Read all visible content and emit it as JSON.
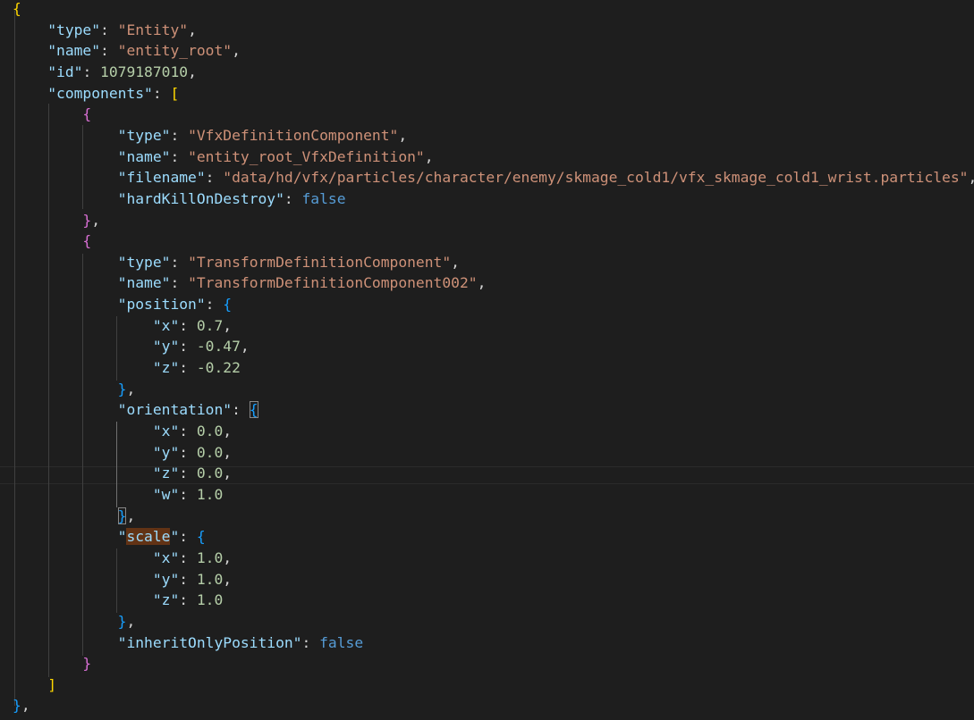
{
  "lines": [
    {
      "indent": 0,
      "tokens": [
        {
          "t": "{",
          "c": "br-gold"
        }
      ]
    },
    {
      "indent": 1,
      "tokens": [
        {
          "t": "\"type\"",
          "c": "k"
        },
        {
          "t": ": ",
          "c": "p"
        },
        {
          "t": "\"Entity\"",
          "c": "s"
        },
        {
          "t": ",",
          "c": "p"
        }
      ]
    },
    {
      "indent": 1,
      "tokens": [
        {
          "t": "\"name\"",
          "c": "k"
        },
        {
          "t": ": ",
          "c": "p"
        },
        {
          "t": "\"entity_root\"",
          "c": "s"
        },
        {
          "t": ",",
          "c": "p"
        }
      ]
    },
    {
      "indent": 1,
      "tokens": [
        {
          "t": "\"id\"",
          "c": "k"
        },
        {
          "t": ": ",
          "c": "p"
        },
        {
          "t": "1079187010",
          "c": "n"
        },
        {
          "t": ",",
          "c": "p"
        }
      ]
    },
    {
      "indent": 1,
      "tokens": [
        {
          "t": "\"components\"",
          "c": "k"
        },
        {
          "t": ": ",
          "c": "p"
        },
        {
          "t": "[",
          "c": "br-gold"
        }
      ]
    },
    {
      "indent": 2,
      "tokens": [
        {
          "t": "{",
          "c": "br-pink"
        }
      ]
    },
    {
      "indent": 3,
      "tokens": [
        {
          "t": "\"type\"",
          "c": "k"
        },
        {
          "t": ": ",
          "c": "p"
        },
        {
          "t": "\"VfxDefinitionComponent\"",
          "c": "s"
        },
        {
          "t": ",",
          "c": "p"
        }
      ]
    },
    {
      "indent": 3,
      "tokens": [
        {
          "t": "\"name\"",
          "c": "k"
        },
        {
          "t": ": ",
          "c": "p"
        },
        {
          "t": "\"entity_root_VfxDefinition\"",
          "c": "s"
        },
        {
          "t": ",",
          "c": "p"
        }
      ]
    },
    {
      "indent": 3,
      "tokens": [
        {
          "t": "\"filename\"",
          "c": "k"
        },
        {
          "t": ": ",
          "c": "p"
        },
        {
          "t": "\"data/hd/vfx/particles/character/enemy/skmage_cold1/vfx_skmage_cold1_wrist.particles\"",
          "c": "s"
        },
        {
          "t": ",",
          "c": "p"
        }
      ]
    },
    {
      "indent": 3,
      "tokens": [
        {
          "t": "\"hardKillOnDestroy\"",
          "c": "k"
        },
        {
          "t": ": ",
          "c": "p"
        },
        {
          "t": "false",
          "c": "b"
        }
      ]
    },
    {
      "indent": 2,
      "tokens": [
        {
          "t": "}",
          "c": "br-pink"
        },
        {
          "t": ",",
          "c": "p"
        }
      ]
    },
    {
      "indent": 2,
      "tokens": [
        {
          "t": "{",
          "c": "br-pink"
        }
      ]
    },
    {
      "indent": 3,
      "tokens": [
        {
          "t": "\"type\"",
          "c": "k"
        },
        {
          "t": ": ",
          "c": "p"
        },
        {
          "t": "\"TransformDefinitionComponent\"",
          "c": "s"
        },
        {
          "t": ",",
          "c": "p"
        }
      ]
    },
    {
      "indent": 3,
      "tokens": [
        {
          "t": "\"name\"",
          "c": "k"
        },
        {
          "t": ": ",
          "c": "p"
        },
        {
          "t": "\"TransformDefinitionComponent002\"",
          "c": "s"
        },
        {
          "t": ",",
          "c": "p"
        }
      ]
    },
    {
      "indent": 3,
      "tokens": [
        {
          "t": "\"position\"",
          "c": "k"
        },
        {
          "t": ": ",
          "c": "p"
        },
        {
          "t": "{",
          "c": "br-blue"
        }
      ]
    },
    {
      "indent": 4,
      "tokens": [
        {
          "t": "\"x\"",
          "c": "k"
        },
        {
          "t": ": ",
          "c": "p"
        },
        {
          "t": "0.7",
          "c": "n"
        },
        {
          "t": ",",
          "c": "p"
        }
      ]
    },
    {
      "indent": 4,
      "tokens": [
        {
          "t": "\"y\"",
          "c": "k"
        },
        {
          "t": ": ",
          "c": "p"
        },
        {
          "t": "-0.47",
          "c": "n"
        },
        {
          "t": ",",
          "c": "p"
        }
      ]
    },
    {
      "indent": 4,
      "tokens": [
        {
          "t": "\"z\"",
          "c": "k"
        },
        {
          "t": ": ",
          "c": "p"
        },
        {
          "t": "-0.22",
          "c": "n"
        }
      ]
    },
    {
      "indent": 3,
      "tokens": [
        {
          "t": "}",
          "c": "br-blue"
        },
        {
          "t": ",",
          "c": "p"
        }
      ]
    },
    {
      "indent": 3,
      "tokens": [
        {
          "t": "\"orientation\"",
          "c": "k"
        },
        {
          "t": ": ",
          "c": "p"
        },
        {
          "t": "{",
          "c": "br-blue",
          "match": true
        }
      ]
    },
    {
      "indent": 4,
      "tokens": [
        {
          "t": "\"x\"",
          "c": "k"
        },
        {
          "t": ": ",
          "c": "p"
        },
        {
          "t": "0.0",
          "c": "n"
        },
        {
          "t": ",",
          "c": "p"
        }
      ]
    },
    {
      "indent": 4,
      "tokens": [
        {
          "t": "\"y\"",
          "c": "k"
        },
        {
          "t": ": ",
          "c": "p"
        },
        {
          "t": "0.0",
          "c": "n"
        },
        {
          "t": ",",
          "c": "p"
        }
      ]
    },
    {
      "indent": 4,
      "tokens": [
        {
          "t": "\"z\"",
          "c": "k"
        },
        {
          "t": ": ",
          "c": "p"
        },
        {
          "t": "0.0",
          "c": "n"
        },
        {
          "t": ",",
          "c": "p"
        }
      ]
    },
    {
      "indent": 4,
      "tokens": [
        {
          "t": "\"w\"",
          "c": "k"
        },
        {
          "t": ": ",
          "c": "p"
        },
        {
          "t": "1.0",
          "c": "n"
        }
      ]
    },
    {
      "indent": 3,
      "tokens": [
        {
          "t": "}",
          "c": "br-blue",
          "match": true
        },
        {
          "t": ",",
          "c": "p"
        }
      ]
    },
    {
      "indent": 3,
      "tokens": [
        {
          "t": "\"",
          "c": "k"
        },
        {
          "t": "scale",
          "c": "k",
          "hl": true
        },
        {
          "t": "\"",
          "c": "k"
        },
        {
          "t": ": ",
          "c": "p"
        },
        {
          "t": "{",
          "c": "br-blue"
        }
      ]
    },
    {
      "indent": 4,
      "tokens": [
        {
          "t": "\"x\"",
          "c": "k"
        },
        {
          "t": ": ",
          "c": "p"
        },
        {
          "t": "1.0",
          "c": "n"
        },
        {
          "t": ",",
          "c": "p"
        }
      ]
    },
    {
      "indent": 4,
      "tokens": [
        {
          "t": "\"y\"",
          "c": "k"
        },
        {
          "t": ": ",
          "c": "p"
        },
        {
          "t": "1.0",
          "c": "n"
        },
        {
          "t": ",",
          "c": "p"
        }
      ]
    },
    {
      "indent": 4,
      "tokens": [
        {
          "t": "\"z\"",
          "c": "k"
        },
        {
          "t": ": ",
          "c": "p"
        },
        {
          "t": "1.0",
          "c": "n"
        }
      ]
    },
    {
      "indent": 3,
      "tokens": [
        {
          "t": "}",
          "c": "br-blue"
        },
        {
          "t": ",",
          "c": "p"
        }
      ]
    },
    {
      "indent": 3,
      "tokens": [
        {
          "t": "\"inheritOnlyPosition\"",
          "c": "k"
        },
        {
          "t": ": ",
          "c": "p"
        },
        {
          "t": "false",
          "c": "b"
        }
      ]
    },
    {
      "indent": 2,
      "tokens": [
        {
          "t": "}",
          "c": "br-pink"
        }
      ]
    },
    {
      "indent": 1,
      "tokens": [
        {
          "t": "]",
          "c": "br-gold"
        }
      ]
    },
    {
      "indent": 0,
      "tokens": [
        {
          "t": "}",
          "c": "br-blue"
        },
        {
          "t": ",",
          "c": "p"
        }
      ]
    }
  ],
  "theme": {
    "background": "#1e1e1e",
    "key": "#9cdcfe",
    "string": "#ce9178",
    "number": "#b5cea8",
    "boolean": "#569cd6",
    "bracket_level1": "#ffd700",
    "bracket_level2": "#da70d6",
    "bracket_level3": "#179fff",
    "find_highlight": "#623315"
  }
}
